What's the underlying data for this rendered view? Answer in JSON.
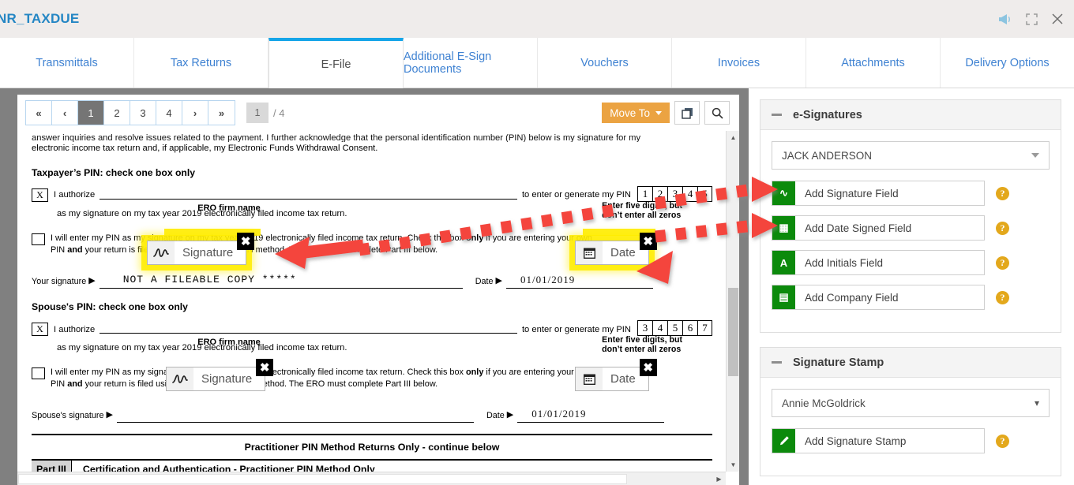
{
  "window": {
    "title": "NR_TAXDUE",
    "icons": {
      "announce": "megaphone-icon",
      "expand": "fullscreen-icon",
      "close": "close-icon"
    }
  },
  "tabs": [
    {
      "label": "Transmittals",
      "active": false
    },
    {
      "label": "Tax Returns",
      "active": false
    },
    {
      "label": "E-File",
      "active": true
    },
    {
      "label": "Additional E-Sign Documents",
      "active": false
    },
    {
      "label": "Vouchers",
      "active": false
    },
    {
      "label": "Invoices",
      "active": false
    },
    {
      "label": "Attachments",
      "active": false
    },
    {
      "label": "Delivery Options",
      "active": false
    }
  ],
  "toolbar": {
    "first": "«",
    "prev": "‹",
    "pages": [
      "1",
      "2",
      "3",
      "4"
    ],
    "active_page": "1",
    "next": "›",
    "last": "»",
    "page_input": "1",
    "page_total": "/ 4",
    "move_to": "Move To",
    "pages_icon": "copy-pages-icon",
    "search_icon": "search-icon"
  },
  "document": {
    "intro_clipped": "answer inquiries and resolve issues related to the payment. I further acknowledge that the personal identification number (PIN) below is my signature for my",
    "intro_line2": "electronic income tax return and, if applicable, my Electronic Funds Withdrawal Consent.",
    "taxpayer": {
      "heading": "Taxpayer’s PIN: check one box only",
      "check_mark": "X",
      "authorize": "I authorize",
      "ero_label": "ERO firm name",
      "pin_prompt": "to enter or generate my PIN",
      "pin_digits": [
        "1",
        "2",
        "3",
        "4",
        "5"
      ],
      "pin_note_l1": "Enter five digits, but",
      "pin_note_l2": "don’t enter all zeros",
      "sub_line": "as my signature on my tax year 2019 electronically filed income tax return.",
      "checkbox_para_1": "I will enter my PIN as my signature on my tax year 2019 electronically filed income tax return. Check this box ",
      "checkbox_para_bold1": "only",
      "checkbox_para_2": " if you are entering your own",
      "checkbox_para_3": "PIN ",
      "checkbox_para_bold2": "and",
      "checkbox_para_4": " your return is filed using the Practitioner PIN method. The ERO must complete Part III below.",
      "signature_caption": "Your signature",
      "date_caption": "Date",
      "watermark": "NOT A FILEABLE COPY *****",
      "date_value": "01/01/2019"
    },
    "spouse": {
      "heading": "Spouse's PIN: check one box only",
      "check_mark": "X",
      "authorize": "I authorize",
      "ero_label": "ERO firm name",
      "pin_prompt": "to enter or generate my PIN",
      "pin_digits": [
        "3",
        "4",
        "5",
        "6",
        "7"
      ],
      "pin_note_l1": "Enter five digits, but",
      "pin_note_l2": "don’t enter all zeros",
      "sub_line": "as my signature on my tax year 2019 electronically filed income tax return.",
      "checkbox_para_1": "I will enter my PIN as my signature on my tax year 2019 electronically filed income tax return. Check this box ",
      "checkbox_para_bold1": "only",
      "checkbox_para_2": " if you are entering your own",
      "checkbox_para_3": "PIN ",
      "checkbox_para_bold2": "and",
      "checkbox_para_4": " your return is filed using the Practitioner PIN method. The ERO must complete Part III below.",
      "signature_caption": "Spouse's signature",
      "date_caption": "Date",
      "date_value": "01/01/2019"
    },
    "practitioner_note": "Practitioner PIN Method Returns Only - continue below",
    "part_label": "Part III",
    "part_title": "Certification and Authentication - Practitioner PIN Method Only"
  },
  "fields": {
    "taxpayer_signature": {
      "label": "Signature",
      "icon": "signature-glyph-icon",
      "close": "✖"
    },
    "taxpayer_date": {
      "label": "Date",
      "icon": "calendar-icon",
      "close": "✖"
    },
    "spouse_signature": {
      "label": "Signature",
      "icon": "signature-glyph-icon",
      "close": "✖"
    },
    "spouse_date": {
      "label": "Date",
      "icon": "calendar-icon",
      "close": "✖"
    }
  },
  "sidebar": {
    "esignatures": {
      "title": "e-Signatures",
      "signer": "JACK ANDERSON",
      "actions": [
        {
          "label": "Add Signature Field",
          "icon": "signature-glyph-icon",
          "glyph": "∿",
          "help": "?"
        },
        {
          "label": "Add Date Signed Field",
          "icon": "calendar-icon",
          "glyph": "▦",
          "help": "?"
        },
        {
          "label": "Add Initials Field",
          "icon": "initials-a-icon",
          "glyph": "A",
          "help": "?"
        },
        {
          "label": "Add Company Field",
          "icon": "company-building-icon",
          "glyph": "▤",
          "help": "?"
        }
      ]
    },
    "stamp": {
      "title": "Signature Stamp",
      "selected": "Annie McGoldrick",
      "action": {
        "label": "Add Signature Stamp",
        "icon": "pencil-icon",
        "glyph": "✐",
        "help": "?"
      }
    }
  },
  "colors": {
    "accent_blue": "#2486c4",
    "tab_link": "#3f82d2",
    "active_tab_underline": "#15a5e8",
    "orange_button": "#eba342",
    "green_icon": "#0c8a0c",
    "help_orange": "#e3a81c",
    "annotation_red": "#f4453c",
    "highlight_yellow": "#ffec00"
  }
}
